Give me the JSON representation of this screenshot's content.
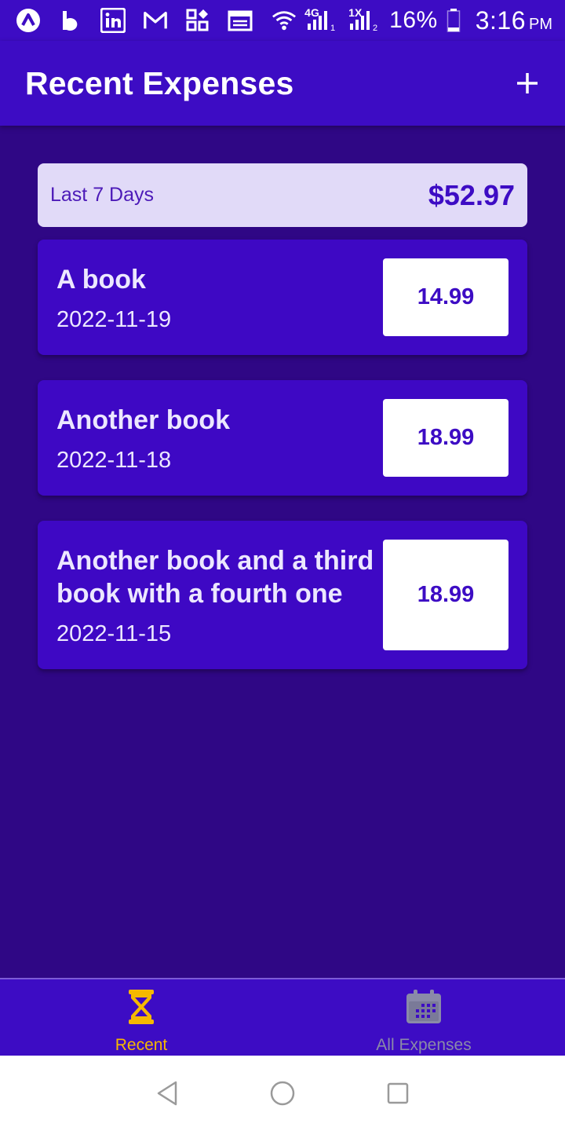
{
  "status_bar": {
    "network_labels": [
      "4G",
      "1X"
    ],
    "battery": "16%",
    "time": "3:16",
    "ampm": "PM",
    "icons": [
      "app-a-icon",
      "app-b-icon",
      "linkedin-icon",
      "gmail-icon",
      "apps-grid-icon",
      "calendar-news-icon",
      "wifi-icon",
      "signal-sim1-icon",
      "signal-sim2-icon",
      "battery-icon"
    ]
  },
  "header": {
    "title": "Recent Expenses",
    "add_icon": "plus-icon"
  },
  "summary": {
    "period_label": "Last 7 Days",
    "total": "$52.97"
  },
  "expenses": [
    {
      "description": "A book",
      "date": "2022-11-19",
      "amount": "14.99"
    },
    {
      "description": "Another book",
      "date": "2022-11-18",
      "amount": "18.99"
    },
    {
      "description": "Another book and a third book with a fourth one",
      "date": "2022-11-15",
      "amount": "18.99"
    }
  ],
  "tabs": [
    {
      "label": "Recent",
      "icon": "hourglass-icon",
      "active": true,
      "color": "#f5b800"
    },
    {
      "label": "All Expenses",
      "icon": "calendar-icon",
      "active": false,
      "color": "#8a8aa8"
    }
  ],
  "nav": [
    "back-icon",
    "home-icon",
    "recents-icon"
  ],
  "colors": {
    "primary": "#3d0cc4",
    "background": "#2f0785",
    "summary_bg": "#e1daf8",
    "accent": "#f5b800"
  }
}
